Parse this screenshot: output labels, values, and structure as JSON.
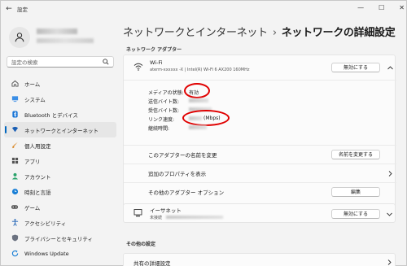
{
  "window": {
    "back_glyph": "←",
    "title": "設定",
    "controls": [
      "—",
      "☐",
      "✕"
    ]
  },
  "sidebar": {
    "search_placeholder": "設定の検索",
    "items": [
      {
        "label": "ホーム",
        "icon": "home-icon"
      },
      {
        "label": "システム",
        "icon": "system-icon"
      },
      {
        "label": "Bluetooth とデバイス",
        "icon": "bluetooth-icon"
      },
      {
        "label": "ネットワークとインターネット",
        "icon": "network-icon",
        "active": true
      },
      {
        "label": "個人用設定",
        "icon": "brush-icon"
      },
      {
        "label": "アプリ",
        "icon": "apps-icon"
      },
      {
        "label": "アカウント",
        "icon": "account-icon"
      },
      {
        "label": "時刻と言語",
        "icon": "clock-icon"
      },
      {
        "label": "ゲーム",
        "icon": "game-icon"
      },
      {
        "label": "アクセシビリティ",
        "icon": "accessibility-icon"
      },
      {
        "label": "プライバシーとセキュリティ",
        "icon": "shield-icon"
      },
      {
        "label": "Windows Update",
        "icon": "update-icon"
      }
    ]
  },
  "header": {
    "parent": "ネットワークとインターネット",
    "separator": "›",
    "title": "ネットワークの詳細設定"
  },
  "adapters": {
    "section_label": "ネットワーク アダプター",
    "wifi": {
      "name": "Wi-Fi",
      "description": "aterm-xxxxxx -X | Intel(R) Wi-Fi 6 AX200 160MHz",
      "disable_button": "無効にする",
      "details": {
        "media_state_label": "メディアの状態:",
        "media_state_value": "有効",
        "sent_label": "送信バイト数:",
        "received_label": "受信バイト数:",
        "link_speed_label": "リンク速度:",
        "link_speed_unit": "(Mbps)",
        "duration_label": "継続時間:"
      },
      "rename_label": "このアダプターの名前を変更",
      "rename_button": "名前を変更する",
      "properties_label": "追加のプロパティを表示",
      "more_options_label": "その他のアダプター オプション",
      "edit_button": "編集"
    },
    "ethernet": {
      "name": "イーサネット",
      "status": "未接続",
      "disable_button": "無効にする"
    }
  },
  "other": {
    "section_label": "その他の設定",
    "sharing_label": "共有の詳細設定"
  },
  "colors": {
    "accent": "#0067c0",
    "highlight": "#e00000"
  }
}
